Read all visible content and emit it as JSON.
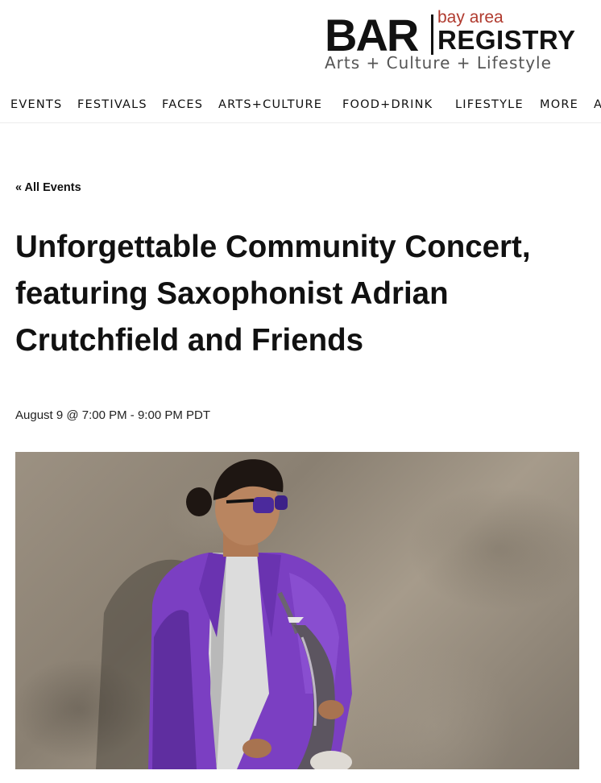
{
  "logo": {
    "bar": "BAR",
    "bay_area": "bay area",
    "registry": "REGISTRY",
    "tagline": "Arts + Culture + Lifestyle"
  },
  "nav": {
    "items": [
      "EVENTS",
      "FESTIVALS",
      "FACES",
      "ARTS+CULTURE",
      "FOOD+DRINK",
      "LIFESTYLE",
      "MORE",
      "A"
    ]
  },
  "event": {
    "back_link": "« All Events",
    "title": "Unforgettable Community Concert, featuring Saxophonist Adrian Crutchfield and Friends",
    "datetime": "August 9 @ 7:00 PM - 9:00 PM PDT"
  },
  "colors": {
    "brand_red": "#b03a2e",
    "suit_purple": "#7b3fc2"
  }
}
